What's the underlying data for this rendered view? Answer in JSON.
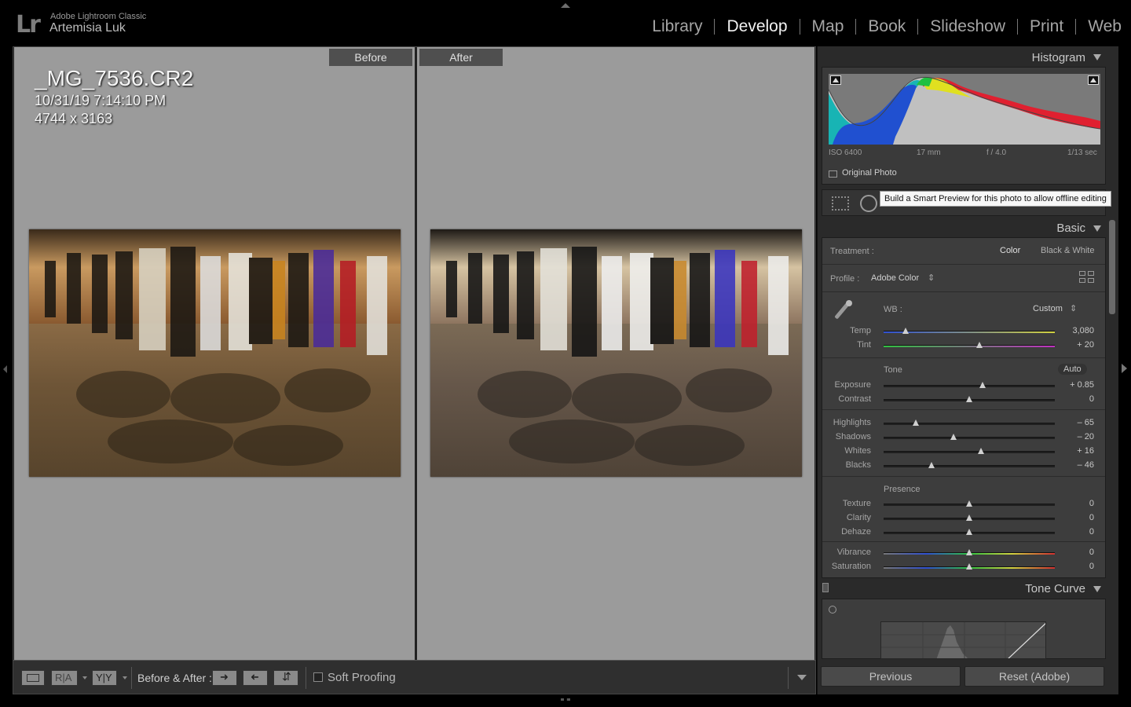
{
  "app": {
    "logo": "Lr",
    "name": "Adobe Lightroom Classic",
    "user": "Artemisia Luk"
  },
  "modules": [
    {
      "label": "Library",
      "active": false
    },
    {
      "label": "Develop",
      "active": true
    },
    {
      "label": "Map",
      "active": false
    },
    {
      "label": "Book",
      "active": false
    },
    {
      "label": "Slideshow",
      "active": false
    },
    {
      "label": "Print",
      "active": false
    },
    {
      "label": "Web",
      "active": false
    }
  ],
  "view": {
    "before_label": "Before",
    "after_label": "After",
    "filename": "_MG_7536.CR2",
    "datetime": "10/31/19 7:14:10 PM",
    "dimensions": "4744 x 3163"
  },
  "toolbar": {
    "before_after_label": "Before & After :",
    "soft_proofing_label": "Soft Proofing",
    "soft_proofing_checked": false
  },
  "histogram": {
    "title": "Histogram",
    "iso": "ISO 6400",
    "focal": "17 mm",
    "aperture": "f / 4.0",
    "shutter": "1/13 sec",
    "original_photo_label": "Original Photo"
  },
  "tooltip": "Build a Smart Preview for this photo to allow offline editing",
  "basic": {
    "title": "Basic",
    "treatment_label": "Treatment :",
    "treatment_color": "Color",
    "treatment_bw": "Black & White",
    "profile_label": "Profile :",
    "profile_value": "Adobe Color",
    "wb_label": "WB :",
    "wb_value": "Custom",
    "tone_label": "Tone",
    "auto_label": "Auto",
    "presence_label": "Presence",
    "sliders": {
      "temp": {
        "label": "Temp",
        "value": "3,080",
        "pos": 0.13
      },
      "tint": {
        "label": "Tint",
        "value": "+ 20",
        "pos": 0.56
      },
      "exposure": {
        "label": "Exposure",
        "value": "+ 0.85",
        "pos": 0.58
      },
      "contrast": {
        "label": "Contrast",
        "value": "0",
        "pos": 0.5
      },
      "highlights": {
        "label": "Highlights",
        "value": "– 65",
        "pos": 0.19
      },
      "shadows": {
        "label": "Shadows",
        "value": "– 20",
        "pos": 0.41
      },
      "whites": {
        "label": "Whites",
        "value": "+ 16",
        "pos": 0.57
      },
      "blacks": {
        "label": "Blacks",
        "value": "– 46",
        "pos": 0.28
      },
      "texture": {
        "label": "Texture",
        "value": "0",
        "pos": 0.5
      },
      "clarity": {
        "label": "Clarity",
        "value": "0",
        "pos": 0.5
      },
      "dehaze": {
        "label": "Dehaze",
        "value": "0",
        "pos": 0.5
      },
      "vibrance": {
        "label": "Vibrance",
        "value": "0",
        "pos": 0.5
      },
      "saturation": {
        "label": "Saturation",
        "value": "0",
        "pos": 0.5
      }
    }
  },
  "tone_curve": {
    "title": "Tone Curve"
  },
  "buttons": {
    "previous": "Previous",
    "reset": "Reset (Adobe)"
  }
}
